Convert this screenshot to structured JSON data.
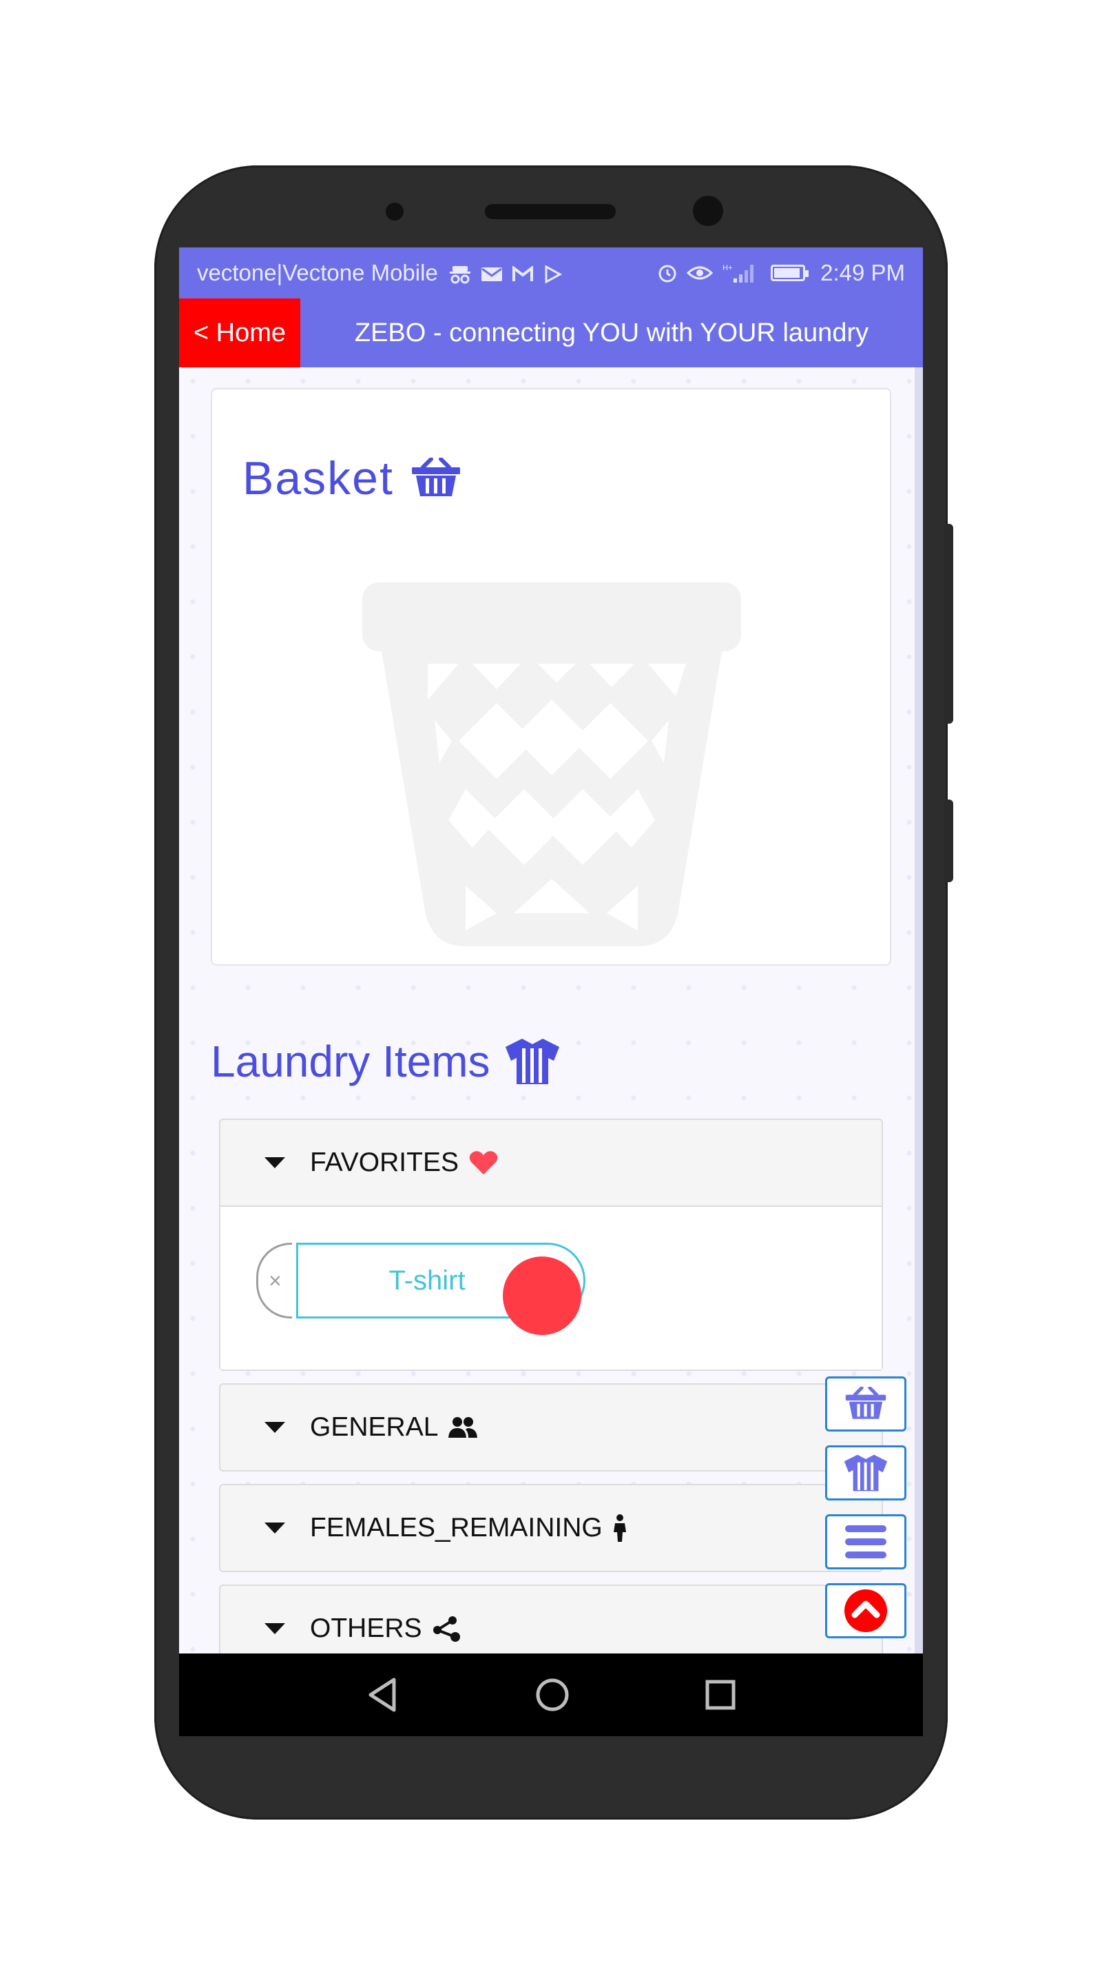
{
  "statusbar": {
    "carrier": "vectone|Vectone Mobile",
    "time": "2:49 PM",
    "icons": [
      "incognito-icon",
      "mail-icon",
      "gmail-icon",
      "play-store-icon",
      "alarm-icon",
      "eye-icon",
      "signal-icon",
      "battery-icon"
    ]
  },
  "appbar": {
    "home_label": "< Home",
    "title": "ZEBO - connecting YOU with YOUR laundry"
  },
  "basket": {
    "title": "Basket",
    "icon": "basket-icon",
    "empty_illustration": "wastebasket-icon"
  },
  "laundry": {
    "title": "Laundry Items",
    "icon": "jersey-icon",
    "sections": [
      {
        "label": "FAVORITES",
        "icon": "heart-icon",
        "expanded": true
      },
      {
        "label": "GENERAL",
        "icon": "users-icon",
        "expanded": false
      },
      {
        "label": "FEMALES_REMAINING",
        "icon": "female-icon",
        "expanded": false
      },
      {
        "label": "OTHERS",
        "icon": "share-nodes-icon",
        "expanded": false
      }
    ],
    "favorites_items": [
      {
        "remove_label": "×",
        "label": "T-shirt"
      }
    ]
  },
  "fabs": [
    "basket-icon",
    "jersey-icon",
    "menu-icon",
    "chevron-up-icon"
  ],
  "colors": {
    "primary": "#6d6fe8",
    "title_text": "#4b4ede",
    "home_button": "#ff0000",
    "item_pill": "#43c3dc",
    "heart": "#ff4757",
    "fab_border": "#2a83d6",
    "up_circle": "#ff0000"
  },
  "navbar": {
    "icons": [
      "back-icon",
      "home-icon",
      "recents-icon"
    ]
  }
}
